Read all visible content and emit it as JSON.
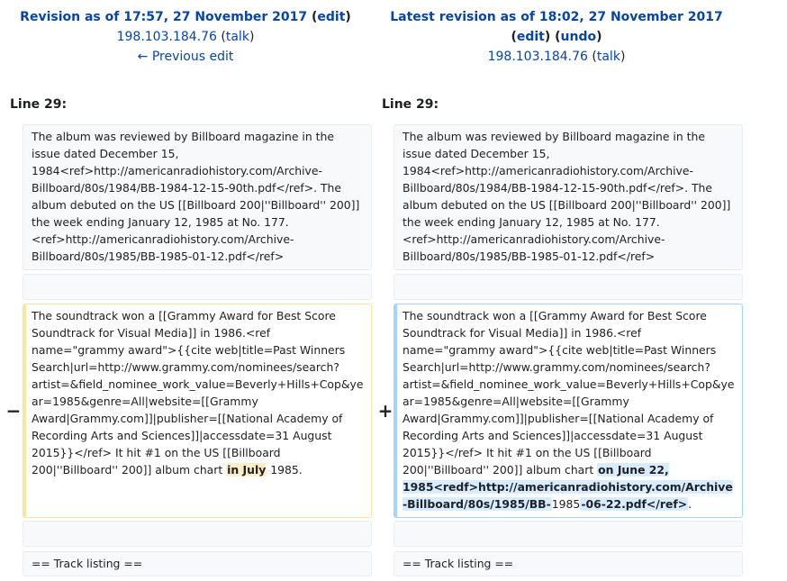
{
  "left": {
    "title_prefix": "Revision as of 17:57, 27 November 2017",
    "edit_label": "edit",
    "user": "198.103.184.76",
    "talk_label": "talk",
    "prev_edit": "← Previous edit",
    "line_label": "Line 29:",
    "marker": "−",
    "para1": "The album was reviewed by Billboard magazine in the issue dated December 15, 1984<ref>http://americanradiohistory.com/Archive-Billboard/80s/1984/BB-1984-12-15-90th.pdf</ref>. The album debuted on the US [[Billboard 200|''Billboard'' 200]] the week ending January 12, 1985 at No. 177. <ref>http://americanradiohistory.com/Archive-Billboard/80s/1985/BB-1985-01-12.pdf</ref>",
    "para2_before": "The soundtrack won a [[Grammy Award for Best Score Soundtrack for Visual Media]] in 1986.<ref name=\"grammy award\">{{cite web|title=Past Winners Search|url=http://www.grammy.com/nominees/search?artist=&field_nominee_work_value=Beverly+Hills+Cop&year=1985&genre=All|website=[[Grammy Award|Grammy.com]]|publisher=[[National Academy of Recording Arts and Sciences]]|accessdate=31 August 2015}}</ref> It hit #1 on the US [[Billboard 200|''Billboard'' 200]] album chart ",
    "para2_changed": "in July",
    "para2_after": " 1985.",
    "para3": "== Track listing =="
  },
  "right": {
    "title": "Latest revision as of 18:02, 27 November 2017",
    "edit_label": "edit",
    "undo_label": "undo",
    "user": "198.103.184.76",
    "talk_label": "talk",
    "line_label": "Line 29:",
    "marker": "+",
    "para1": "The album was reviewed by Billboard magazine in the issue dated December 15, 1984<ref>http://americanradiohistory.com/Archive-Billboard/80s/1984/BB-1984-12-15-90th.pdf</ref>. The album debuted on the US [[Billboard 200|''Billboard'' 200]] the week ending January 12, 1985 at No. 177. <ref>http://americanradiohistory.com/Archive-Billboard/80s/1985/BB-1985-01-12.pdf</ref>",
    "para2_before": "The soundtrack won a [[Grammy Award for Best Score Soundtrack for Visual Media]] in 1986.<ref name=\"grammy award\">{{cite web|title=Past Winners Search|url=http://www.grammy.com/nominees/search?artist=&field_nominee_work_value=Beverly+Hills+Cop&year=1985&genre=All|website=[[Grammy Award|Grammy.com]]|publisher=[[National Academy of Recording Arts and Sciences]]|accessdate=31 August 2015}}</ref> It hit #1 on the US [[Billboard 200|''Billboard'' 200]] album chart ",
    "para2_changed_a": "on June 22, 1985<redf>http://americanradiohistory.com/Archive-Billboard/80s/1985/BB-",
    "para2_mid": "1985",
    "para2_changed_b": "-06-22.pdf</ref>",
    "para2_after": ".",
    "para3": "== Track listing =="
  }
}
